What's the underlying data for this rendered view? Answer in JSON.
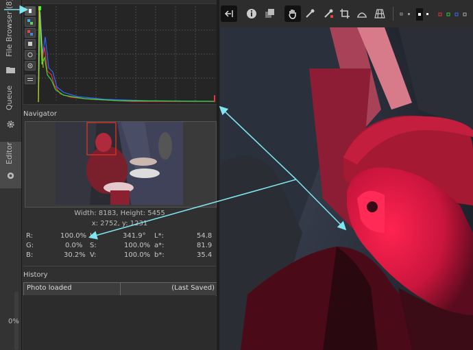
{
  "tabs": {
    "file_browser": "File Browser (8)",
    "queue": "Queue",
    "editor": "Editor"
  },
  "navigator": {
    "title": "Navigator",
    "dimensions": "Width: 8183, Height: 5455",
    "coords": "x: 2752, y: 1231",
    "readout": {
      "r_label": "R:",
      "r": "100.0%",
      "g_label": "G:",
      "g": "0.0%",
      "b_label": "B:",
      "b": "30.2%",
      "h_label": "H:",
      "h": "341.9°",
      "s_label": "S:",
      "s": "100.0%",
      "v_label": "V:",
      "v": "100.0%",
      "l_label": "L*:",
      "l": "54.8",
      "a_label": "a*:",
      "a": "81.9",
      "bb_label": "b*:",
      "bb": "35.4"
    }
  },
  "history": {
    "title": "History",
    "row_action": "Photo loaded",
    "row_state": "(Last Saved)"
  },
  "progress": "0%",
  "colors": {
    "accent_arrow": "#7fe5ee",
    "panel": "#303030",
    "toolbar": "#2d2d2d"
  },
  "toolbar_icons": [
    "panel-toggle-icon",
    "info-icon",
    "before-after-icon",
    "hand-icon",
    "color-picker-icon",
    "wb-picker-icon",
    "crop-icon",
    "straighten-icon",
    "perspective-icon",
    "preview-mode-icons"
  ]
}
